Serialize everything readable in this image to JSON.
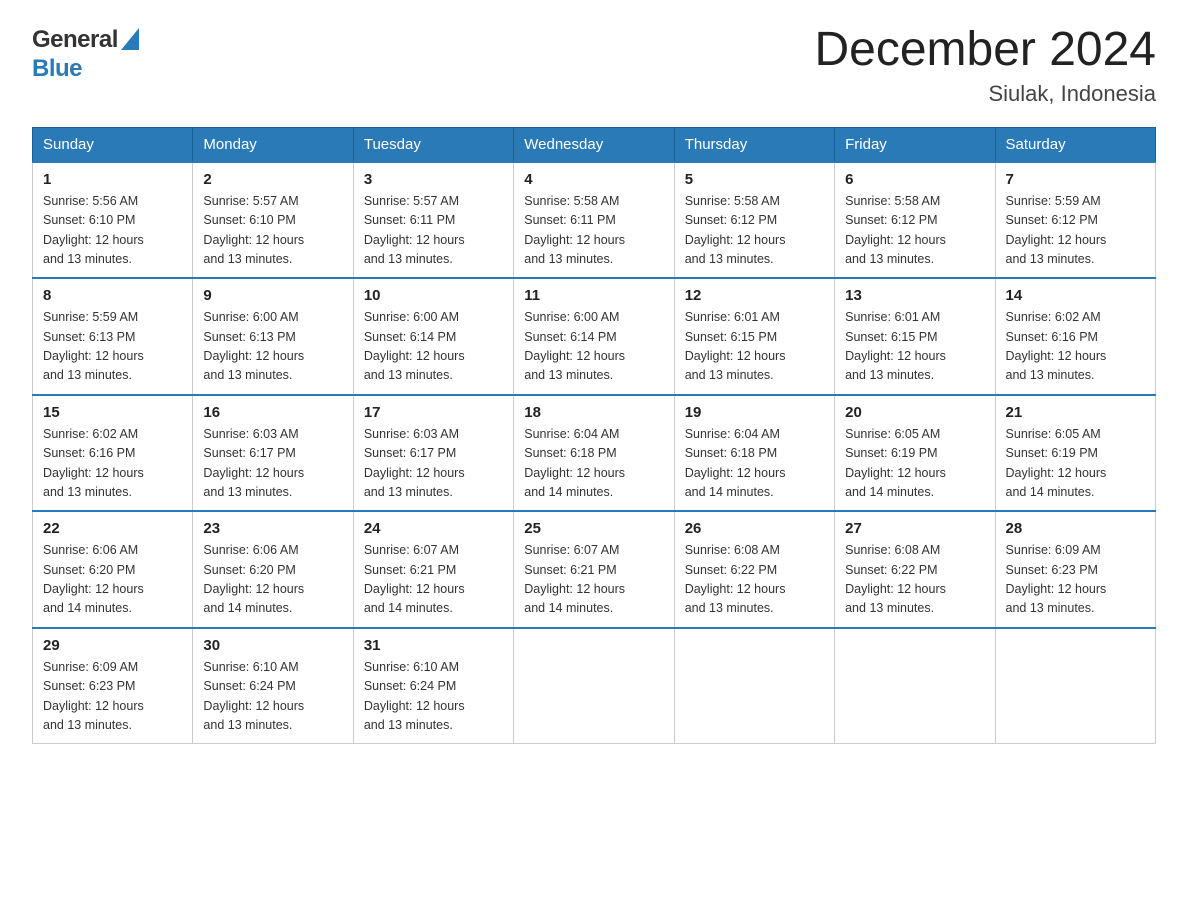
{
  "logo": {
    "text_general": "General",
    "text_blue": "Blue"
  },
  "title": "December 2024",
  "subtitle": "Siulak, Indonesia",
  "weekdays": [
    "Sunday",
    "Monday",
    "Tuesday",
    "Wednesday",
    "Thursday",
    "Friday",
    "Saturday"
  ],
  "weeks": [
    [
      {
        "day": "1",
        "info": "Sunrise: 5:56 AM\nSunset: 6:10 PM\nDaylight: 12 hours\nand 13 minutes."
      },
      {
        "day": "2",
        "info": "Sunrise: 5:57 AM\nSunset: 6:10 PM\nDaylight: 12 hours\nand 13 minutes."
      },
      {
        "day": "3",
        "info": "Sunrise: 5:57 AM\nSunset: 6:11 PM\nDaylight: 12 hours\nand 13 minutes."
      },
      {
        "day": "4",
        "info": "Sunrise: 5:58 AM\nSunset: 6:11 PM\nDaylight: 12 hours\nand 13 minutes."
      },
      {
        "day": "5",
        "info": "Sunrise: 5:58 AM\nSunset: 6:12 PM\nDaylight: 12 hours\nand 13 minutes."
      },
      {
        "day": "6",
        "info": "Sunrise: 5:58 AM\nSunset: 6:12 PM\nDaylight: 12 hours\nand 13 minutes."
      },
      {
        "day": "7",
        "info": "Sunrise: 5:59 AM\nSunset: 6:12 PM\nDaylight: 12 hours\nand 13 minutes."
      }
    ],
    [
      {
        "day": "8",
        "info": "Sunrise: 5:59 AM\nSunset: 6:13 PM\nDaylight: 12 hours\nand 13 minutes."
      },
      {
        "day": "9",
        "info": "Sunrise: 6:00 AM\nSunset: 6:13 PM\nDaylight: 12 hours\nand 13 minutes."
      },
      {
        "day": "10",
        "info": "Sunrise: 6:00 AM\nSunset: 6:14 PM\nDaylight: 12 hours\nand 13 minutes."
      },
      {
        "day": "11",
        "info": "Sunrise: 6:00 AM\nSunset: 6:14 PM\nDaylight: 12 hours\nand 13 minutes."
      },
      {
        "day": "12",
        "info": "Sunrise: 6:01 AM\nSunset: 6:15 PM\nDaylight: 12 hours\nand 13 minutes."
      },
      {
        "day": "13",
        "info": "Sunrise: 6:01 AM\nSunset: 6:15 PM\nDaylight: 12 hours\nand 13 minutes."
      },
      {
        "day": "14",
        "info": "Sunrise: 6:02 AM\nSunset: 6:16 PM\nDaylight: 12 hours\nand 13 minutes."
      }
    ],
    [
      {
        "day": "15",
        "info": "Sunrise: 6:02 AM\nSunset: 6:16 PM\nDaylight: 12 hours\nand 13 minutes."
      },
      {
        "day": "16",
        "info": "Sunrise: 6:03 AM\nSunset: 6:17 PM\nDaylight: 12 hours\nand 13 minutes."
      },
      {
        "day": "17",
        "info": "Sunrise: 6:03 AM\nSunset: 6:17 PM\nDaylight: 12 hours\nand 13 minutes."
      },
      {
        "day": "18",
        "info": "Sunrise: 6:04 AM\nSunset: 6:18 PM\nDaylight: 12 hours\nand 14 minutes."
      },
      {
        "day": "19",
        "info": "Sunrise: 6:04 AM\nSunset: 6:18 PM\nDaylight: 12 hours\nand 14 minutes."
      },
      {
        "day": "20",
        "info": "Sunrise: 6:05 AM\nSunset: 6:19 PM\nDaylight: 12 hours\nand 14 minutes."
      },
      {
        "day": "21",
        "info": "Sunrise: 6:05 AM\nSunset: 6:19 PM\nDaylight: 12 hours\nand 14 minutes."
      }
    ],
    [
      {
        "day": "22",
        "info": "Sunrise: 6:06 AM\nSunset: 6:20 PM\nDaylight: 12 hours\nand 14 minutes."
      },
      {
        "day": "23",
        "info": "Sunrise: 6:06 AM\nSunset: 6:20 PM\nDaylight: 12 hours\nand 14 minutes."
      },
      {
        "day": "24",
        "info": "Sunrise: 6:07 AM\nSunset: 6:21 PM\nDaylight: 12 hours\nand 14 minutes."
      },
      {
        "day": "25",
        "info": "Sunrise: 6:07 AM\nSunset: 6:21 PM\nDaylight: 12 hours\nand 14 minutes."
      },
      {
        "day": "26",
        "info": "Sunrise: 6:08 AM\nSunset: 6:22 PM\nDaylight: 12 hours\nand 13 minutes."
      },
      {
        "day": "27",
        "info": "Sunrise: 6:08 AM\nSunset: 6:22 PM\nDaylight: 12 hours\nand 13 minutes."
      },
      {
        "day": "28",
        "info": "Sunrise: 6:09 AM\nSunset: 6:23 PM\nDaylight: 12 hours\nand 13 minutes."
      }
    ],
    [
      {
        "day": "29",
        "info": "Sunrise: 6:09 AM\nSunset: 6:23 PM\nDaylight: 12 hours\nand 13 minutes."
      },
      {
        "day": "30",
        "info": "Sunrise: 6:10 AM\nSunset: 6:24 PM\nDaylight: 12 hours\nand 13 minutes."
      },
      {
        "day": "31",
        "info": "Sunrise: 6:10 AM\nSunset: 6:24 PM\nDaylight: 12 hours\nand 13 minutes."
      },
      {
        "day": "",
        "info": ""
      },
      {
        "day": "",
        "info": ""
      },
      {
        "day": "",
        "info": ""
      },
      {
        "day": "",
        "info": ""
      }
    ]
  ]
}
